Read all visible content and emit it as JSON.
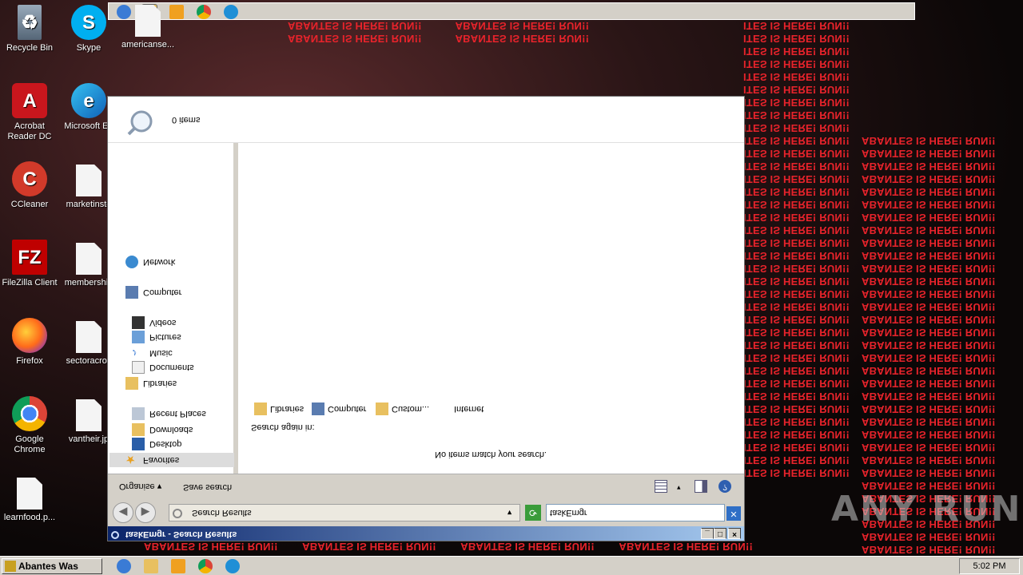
{
  "wallpaper": {
    "banner": "ABANTES IS HERE! RUN!!",
    "banner_partial": "ITES IS HERE! RUN!!"
  },
  "desktop_icons": [
    {
      "label": "Recycle Bin",
      "icon": "recycle-bin-icon"
    },
    {
      "label": "Skype",
      "icon": "skype-icon"
    },
    {
      "label": "americanse...",
      "icon": "document-icon"
    },
    {
      "label": "Acrobat Reader DC",
      "icon": "acrobat-icon"
    },
    {
      "label": "Microsoft Ed",
      "icon": "edge-icon"
    },
    {
      "label": "CCleaner",
      "icon": "ccleaner-icon"
    },
    {
      "label": "marketinste",
      "icon": "document-icon"
    },
    {
      "label": "FileZilla Client",
      "icon": "filezilla-icon"
    },
    {
      "label": "membership",
      "icon": "document-icon"
    },
    {
      "label": "Firefox",
      "icon": "firefox-icon"
    },
    {
      "label": "sectoracros",
      "icon": "document-icon"
    },
    {
      "label": "Google Chrome",
      "icon": "chrome-icon"
    },
    {
      "label": "vantheir.jp",
      "icon": "document-icon"
    },
    {
      "label": "learnfood.p...",
      "icon": "document-icon"
    }
  ],
  "window": {
    "title": "taskEmgr - Search Results",
    "address_crumb": "Search Results",
    "search_value": "taskEmgr",
    "toolbar": {
      "organise": "Organise",
      "save_search": "Save search"
    },
    "nav": {
      "favorites": "Favorites",
      "desktop": "Desktop",
      "downloads": "Downloads",
      "recent": "Recent Places",
      "libraries": "Libraries",
      "documents": "Documents",
      "music": "Music",
      "pictures": "Pictures",
      "videos": "Videos",
      "computer": "Computer",
      "network": "Network"
    },
    "content": {
      "no_match": "No items match your search.",
      "search_again": "Search again in:",
      "locations": [
        "Libraries",
        "Computer",
        "Custom...",
        "Internet"
      ]
    },
    "details": {
      "count": "0 items"
    }
  },
  "taskbar": {
    "start_label": "Abantes Was Here",
    "clock": "5:02 PM"
  },
  "watermark": "ANY RUN",
  "colors": {
    "banner_red": "#e8232b",
    "title_blue": "#0a246a"
  }
}
